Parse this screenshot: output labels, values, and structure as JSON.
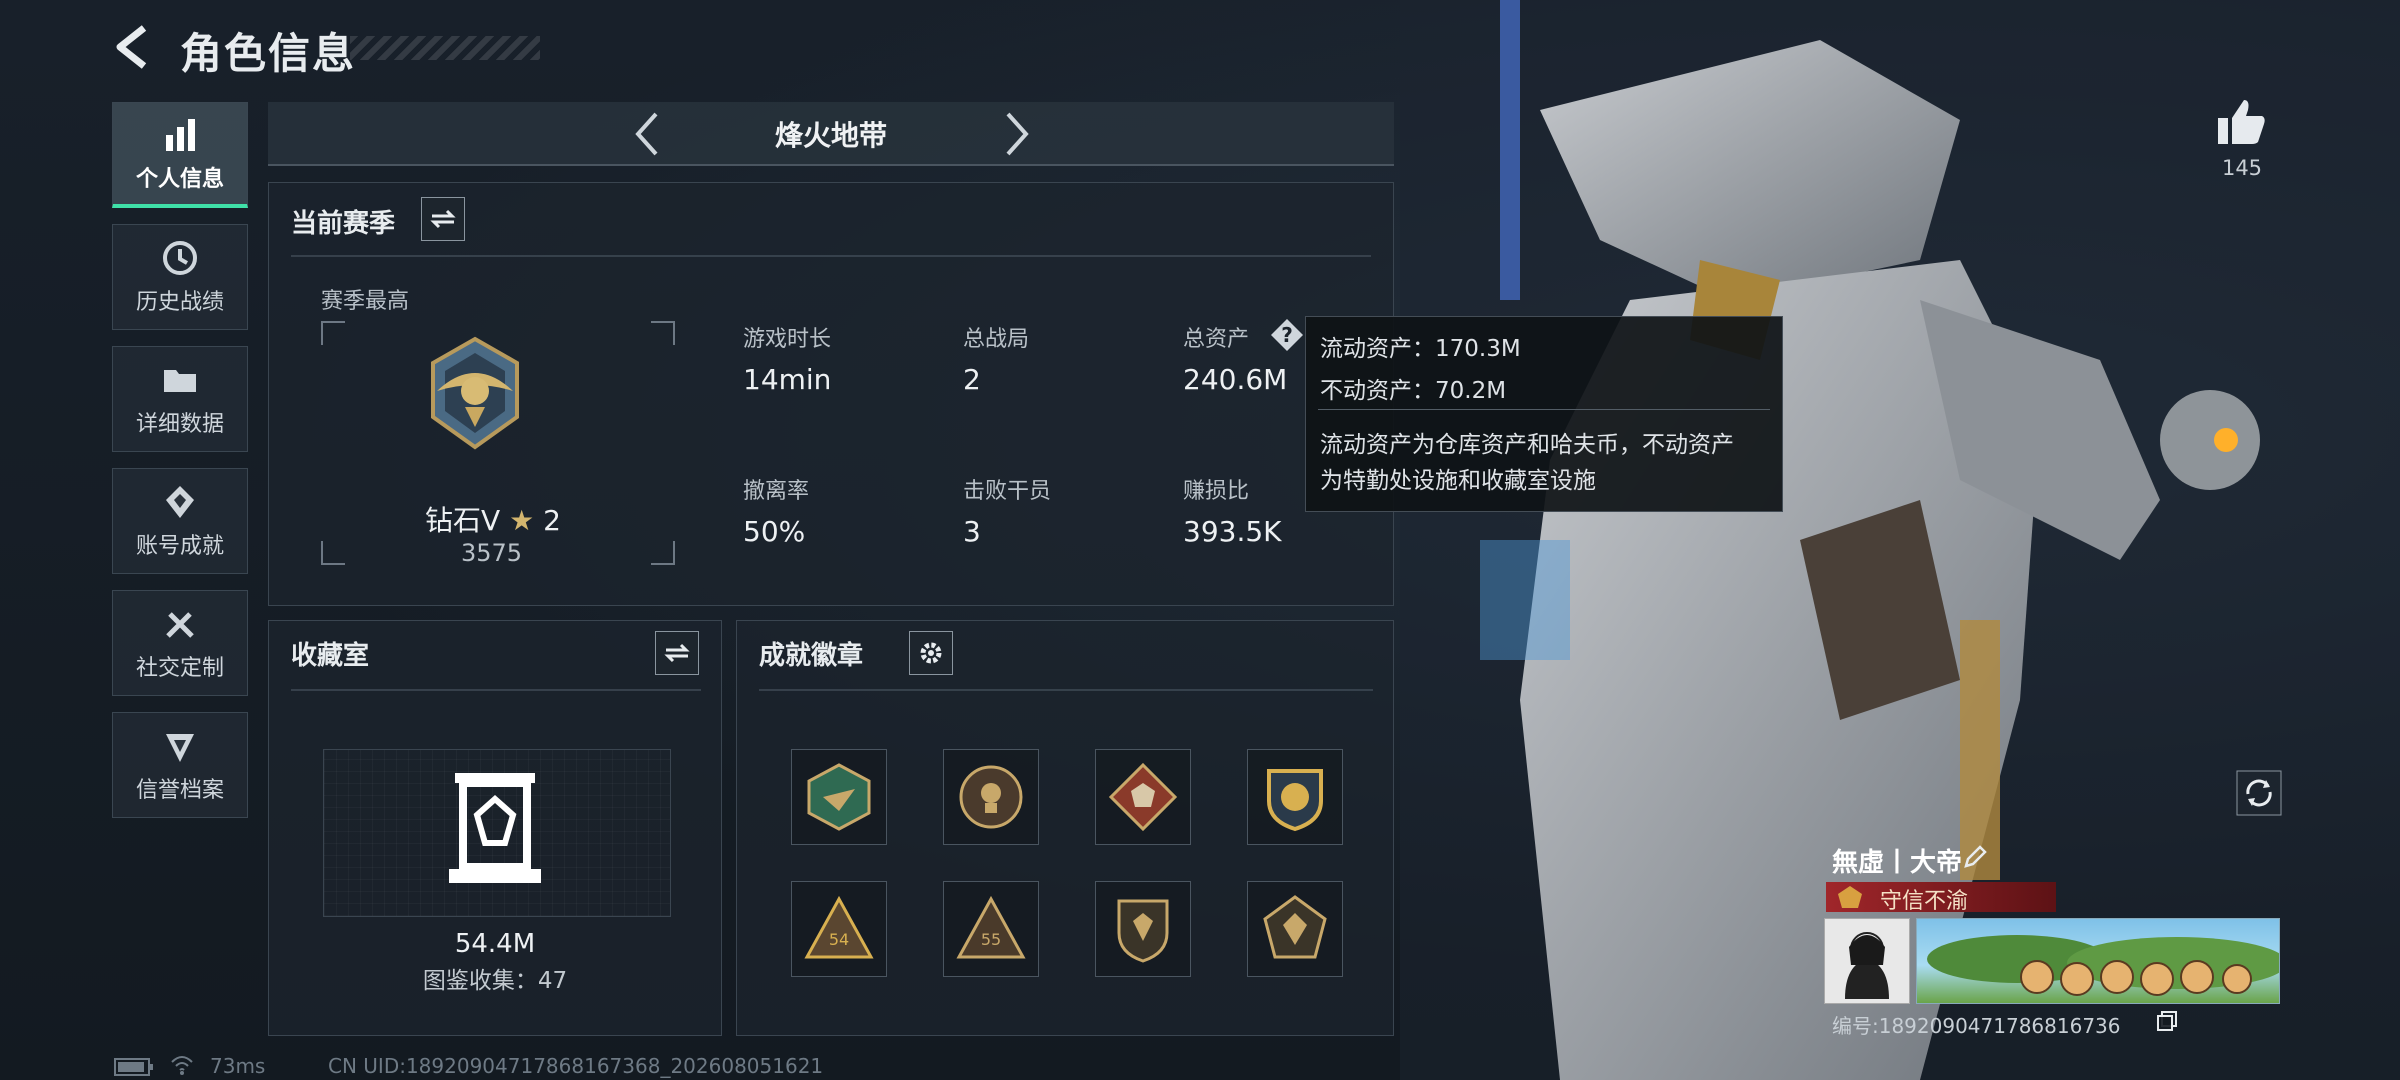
{
  "header": {
    "title": "角色信息"
  },
  "sidebar": {
    "items": [
      {
        "label": "个人信息",
        "icon": "bar-chart-icon",
        "active": true
      },
      {
        "label": "历史战绩",
        "icon": "history-icon",
        "active": false
      },
      {
        "label": "详细数据",
        "icon": "folder-icon",
        "active": false
      },
      {
        "label": "账号成就",
        "icon": "achievement-icon",
        "active": false
      },
      {
        "label": "社交定制",
        "icon": "tools-icon",
        "active": false
      },
      {
        "label": "信誉档案",
        "icon": "credit-icon",
        "active": false
      }
    ]
  },
  "mode": {
    "name": "烽火地带"
  },
  "season": {
    "title": "当前赛季",
    "best_label": "赛季最高",
    "rank_name": "钻石V",
    "rank_stars": "2",
    "rank_score": "3575",
    "stats": [
      {
        "label": "游戏时长",
        "value": "14min"
      },
      {
        "label": "总战局",
        "value": "2"
      },
      {
        "label": "总资产",
        "value": "240.6M"
      },
      {
        "label": "撤离率",
        "value": "50%"
      },
      {
        "label": "击败干员",
        "value": "3"
      },
      {
        "label": "赚损比",
        "value": "393.5K"
      }
    ]
  },
  "tooltip": {
    "liquid": "流动资产：170.3M",
    "fixed": "不动资产：70.2M",
    "desc_line1": "流动资产为仓库资产和哈夫币，不动资产",
    "desc_line2": "为特勤处设施和收藏室设施"
  },
  "collection": {
    "title": "收藏室",
    "value": "54.4M",
    "count_text": "图鉴收集：47"
  },
  "badges": {
    "title": "成就徽章",
    "items": [
      "hexagon-wasp-badge",
      "round-skull-badge",
      "diamond-wolf-badge",
      "shield-gold-badge",
      "triangle-54-badge",
      "triangle-55-badge",
      "shield-emblem-badge",
      "pentagon-emblem-badge"
    ]
  },
  "profile": {
    "likes": "145",
    "name": "無虛丨大帝",
    "title_badge": "守信不渝",
    "id_text": "编号:1892090471786816736"
  },
  "status_bar": {
    "ping": "73ms",
    "uid": "CN UID:18920904717868167368_202608051621"
  },
  "colors": {
    "accent": "#3fe0a8",
    "title_badge": "#a0262a"
  }
}
